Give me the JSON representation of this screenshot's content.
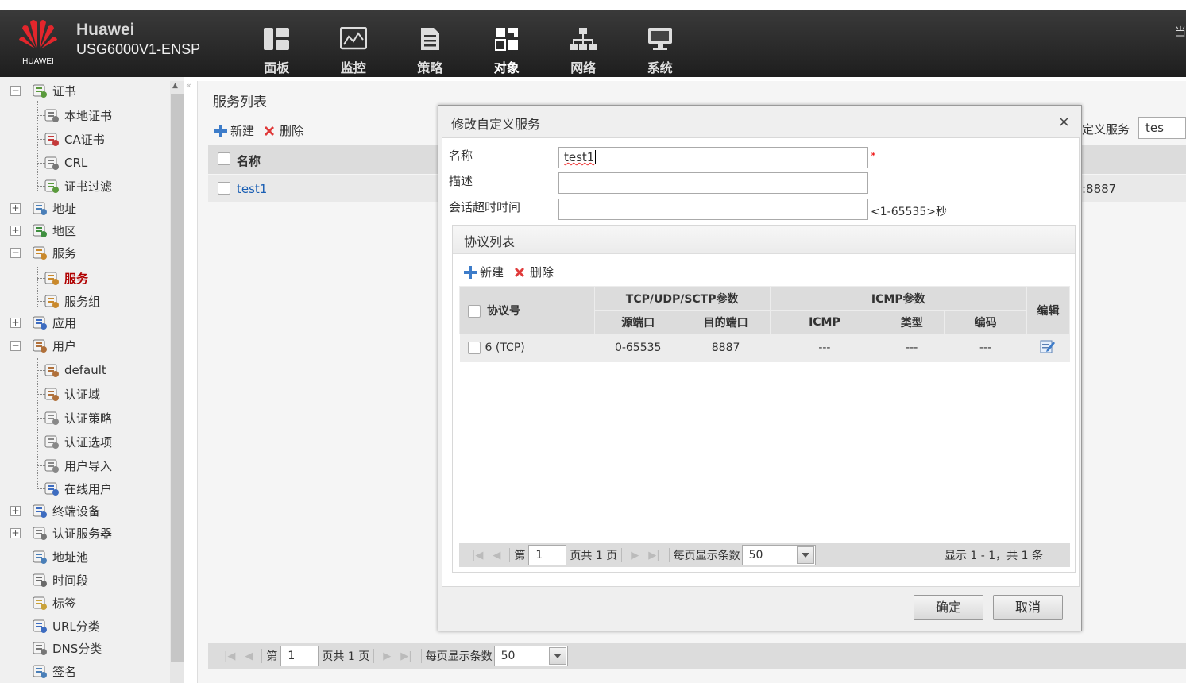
{
  "header": {
    "logo_text": "HUAWEI",
    "brand": "Huawei",
    "model": "USG6000V1-ENSP",
    "right_glyph": "当",
    "nav": [
      {
        "label": "面板",
        "icon": "dashboard-icon"
      },
      {
        "label": "监控",
        "icon": "monitor-icon"
      },
      {
        "label": "策略",
        "icon": "policy-icon"
      },
      {
        "label": "对象",
        "icon": "object-icon",
        "active": true
      },
      {
        "label": "网络",
        "icon": "network-icon"
      },
      {
        "label": "系统",
        "icon": "system-icon"
      }
    ]
  },
  "sidebar": {
    "items": [
      {
        "label": "证书",
        "expander": "−"
      },
      {
        "label": "本地证书"
      },
      {
        "label": "CA证书"
      },
      {
        "label": "CRL"
      },
      {
        "label": "证书过滤"
      },
      {
        "label": "地址",
        "expander": "+"
      },
      {
        "label": "地区",
        "expander": "+"
      },
      {
        "label": "服务",
        "expander": "−"
      },
      {
        "label": "服务",
        "selected": true
      },
      {
        "label": "服务组"
      },
      {
        "label": "应用",
        "expander": "+"
      },
      {
        "label": "用户",
        "expander": "−"
      },
      {
        "label": "default"
      },
      {
        "label": "认证域"
      },
      {
        "label": "认证策略"
      },
      {
        "label": "认证选项"
      },
      {
        "label": "用户导入"
      },
      {
        "label": "在线用户"
      },
      {
        "label": "终端设备",
        "expander": "+"
      },
      {
        "label": "认证服务器",
        "expander": "+"
      },
      {
        "label": "地址池"
      },
      {
        "label": "时间段"
      },
      {
        "label": "标签"
      },
      {
        "label": "URL分类"
      },
      {
        "label": "DNS分类"
      },
      {
        "label": "签名"
      }
    ]
  },
  "main": {
    "title": "服务列表",
    "new_label": "新建",
    "delete_label": "删除",
    "col_name": "名称",
    "rows": [
      {
        "name": "test1"
      }
    ],
    "search_label": "定义服务",
    "search_value": "tes",
    "peek_port": ":8887",
    "pager": {
      "page_prefix": "第",
      "page": "1",
      "page_suffix": "页共 1 页",
      "per_page_label": "每页显示条数",
      "per_page": "50"
    }
  },
  "dialog": {
    "title": "修改自定义服务",
    "close": "×",
    "name_label": "名称",
    "name_value": "test1",
    "required_mark": "*",
    "desc_label": "描述",
    "desc_value": "",
    "timeout_label": "会话超时时间",
    "timeout_value": "",
    "timeout_hint": "<1-65535>秒",
    "proto_title": "协议列表",
    "new_label": "新建",
    "delete_label": "删除",
    "columns": {
      "protocol": "协议号",
      "tcp_group": "TCP/UDP/SCTP参数",
      "src_port": "源端口",
      "dst_port": "目的端口",
      "icmp_group": "ICMP参数",
      "icmp": "ICMP",
      "type": "类型",
      "code": "编码",
      "edit": "编辑"
    },
    "rows": [
      {
        "protocol": "6 (TCP)",
        "src_port": "0-65535",
        "dst_port": "8887",
        "icmp": "---",
        "type": "---",
        "code": "---"
      }
    ],
    "pager": {
      "page_prefix": "第",
      "page": "1",
      "page_suffix": "页共 1 页",
      "per_page_label": "每页显示条数",
      "per_page": "50",
      "summary": "显示 1 - 1，共 1 条"
    },
    "ok": "确定",
    "cancel": "取消"
  }
}
